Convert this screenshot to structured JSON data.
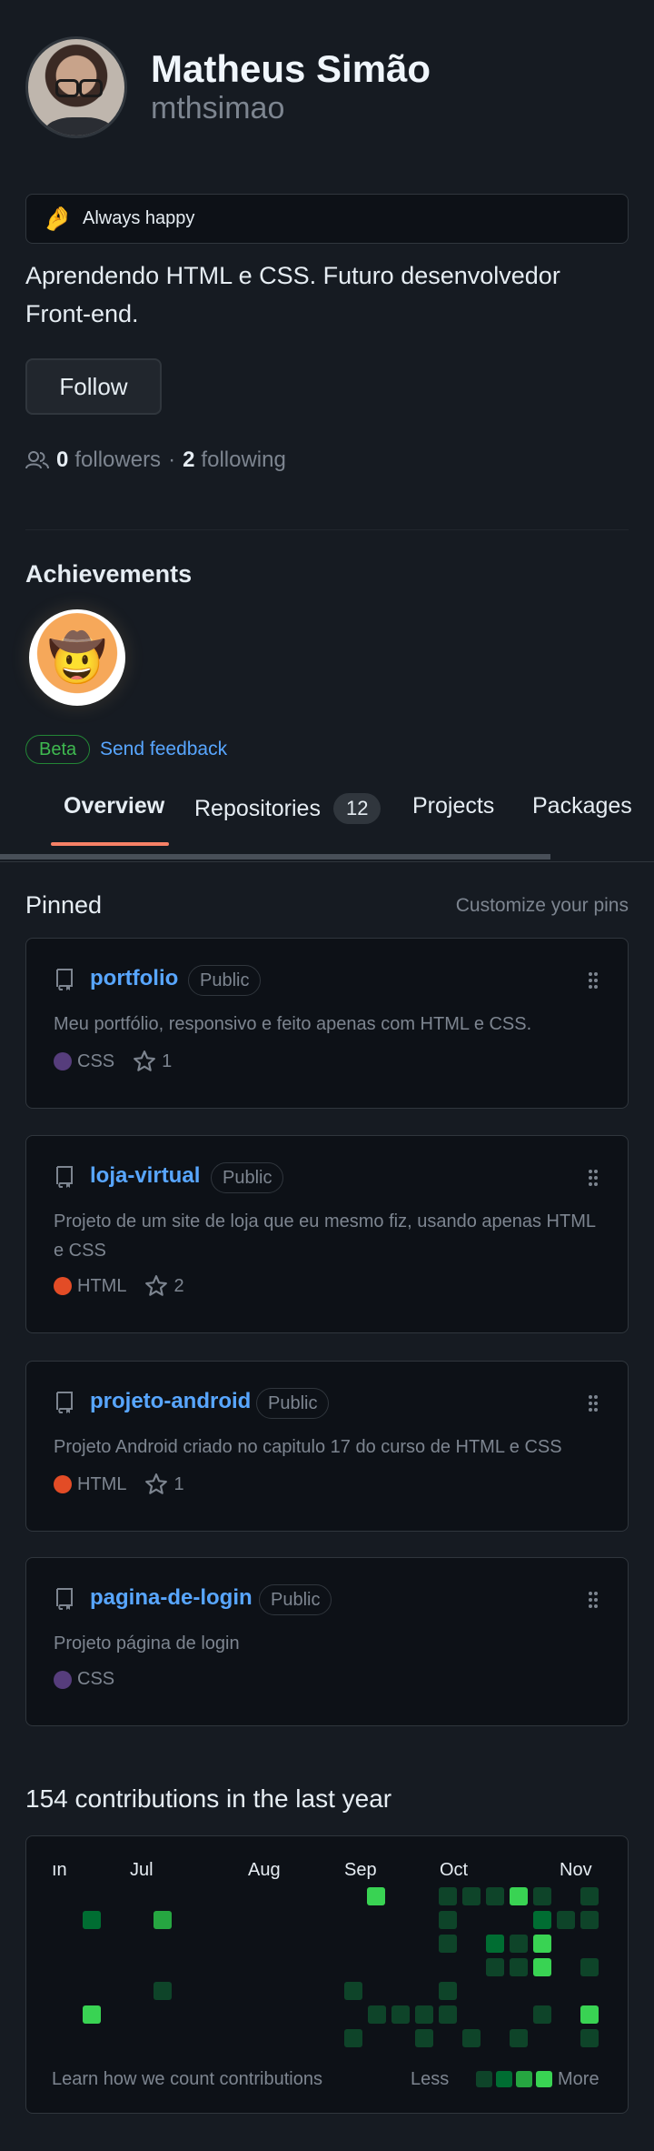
{
  "profile": {
    "fullname": "Matheus Simão",
    "username": "mthsimao",
    "status_emoji": "🤌",
    "status_text": "Always happy",
    "bio": "Aprendendo HTML e CSS. Futuro desenvolvedor Front-end.",
    "follow_label": "Follow",
    "followers_count": "0",
    "followers_label": "followers",
    "following_count": "2",
    "following_label": "following",
    "separator": "·"
  },
  "achievements": {
    "title": "Achievements",
    "badge_emoji": "🤠",
    "beta_label": "Beta",
    "feedback_label": "Send feedback"
  },
  "tabs": [
    {
      "label": "Overview",
      "active": true
    },
    {
      "label": "Repositories",
      "count": "12"
    },
    {
      "label": "Projects"
    },
    {
      "label": "Packages"
    }
  ],
  "pinned": {
    "title": "Pinned",
    "customize_label": "Customize your pins",
    "repos": [
      {
        "name": "portfolio",
        "visibility": "Public",
        "description": "Meu portfólio, responsivo e feito apenas com HTML e CSS.",
        "language": "CSS",
        "language_color": "#563d7c",
        "stars": "1"
      },
      {
        "name": "loja-virtual",
        "visibility": "Public",
        "description": "Projeto de um site de loja que eu mesmo fiz, usando apenas HTML e CSS",
        "language": "HTML",
        "language_color": "#e34c26",
        "stars": "2"
      },
      {
        "name": "projeto-android",
        "visibility": "Public",
        "description": "Projeto Android criado no capitulo 17 do curso de HTML e CSS",
        "language": "HTML",
        "language_color": "#e34c26",
        "stars": "1"
      },
      {
        "name": "pagina-de-login",
        "visibility": "Public",
        "description": "Projeto página de login",
        "language": "CSS",
        "language_color": "#563d7c",
        "stars": null
      }
    ]
  },
  "contributions": {
    "title": "154 contributions in the last year",
    "months": [
      "ın",
      "Jul",
      "Aug",
      "Sep",
      "Oct",
      "Nov"
    ],
    "learn_label": "Learn how we count contributions",
    "less_label": "Less",
    "more_label": "More",
    "level_colors": [
      "#0e4429",
      "#006d32",
      "#26a641",
      "#39d353"
    ]
  }
}
